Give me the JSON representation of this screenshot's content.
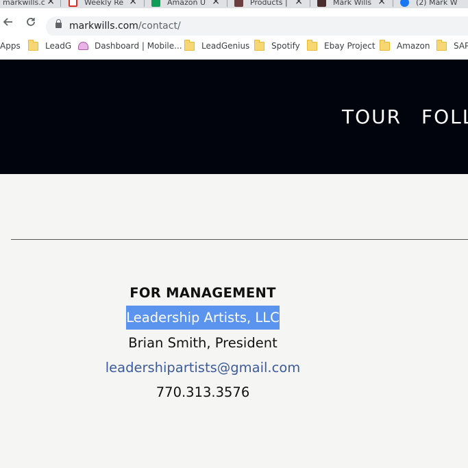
{
  "tabs": [
    {
      "title": "markwills.c",
      "favicon": "page-icon",
      "color": "#ffffff"
    },
    {
      "title": "Weekly Re",
      "favicon": "gmail-icon",
      "color": "#d93025"
    },
    {
      "title": "Amazon U",
      "favicon": "sheets-icon",
      "color": "#0f9d58"
    },
    {
      "title": "Products |",
      "favicon": "photo-icon",
      "color": "#6b3f3f"
    },
    {
      "title": "Mark Wills",
      "favicon": "photo-icon",
      "color": "#4a2e2e"
    },
    {
      "title": "(2) Mark W",
      "favicon": "facebook-icon",
      "color": "#1877f2"
    }
  ],
  "toolbar": {
    "back_icon": "back-arrow-icon",
    "forward_icon": "forward-arrow-icon",
    "reload_icon": "reload-icon",
    "url_host": "markwills.com",
    "url_path": "/contact/"
  },
  "bookmarks": [
    {
      "label": "Apps",
      "icon": "apps-icon"
    },
    {
      "label": "LeadG",
      "icon": "folder-icon"
    },
    {
      "label": "Dashboard | Mobile...",
      "icon": "helmet-icon"
    },
    {
      "label": "LeadGenius",
      "icon": "folder-icon"
    },
    {
      "label": "Spotify",
      "icon": "folder-icon"
    },
    {
      "label": "Ebay Project",
      "icon": "folder-icon"
    },
    {
      "label": "Amazon",
      "icon": "folder-icon"
    },
    {
      "label": "SAP",
      "icon": "folder-icon"
    }
  ],
  "site_nav": [
    {
      "label": "TOUR"
    },
    {
      "label": "FOLL"
    }
  ],
  "contact": {
    "heading": "FOR MANAGEMENT",
    "company": "Leadership Artists, LLC",
    "person": "Brian Smith, President",
    "email": "leadershipartists@gmail.com",
    "phone": "770.313.3576"
  },
  "colors": {
    "header_bg": "#01040d",
    "page_bg": "#f5f5f3",
    "selection": "#5a94ee",
    "link": "#3b5b9e"
  }
}
